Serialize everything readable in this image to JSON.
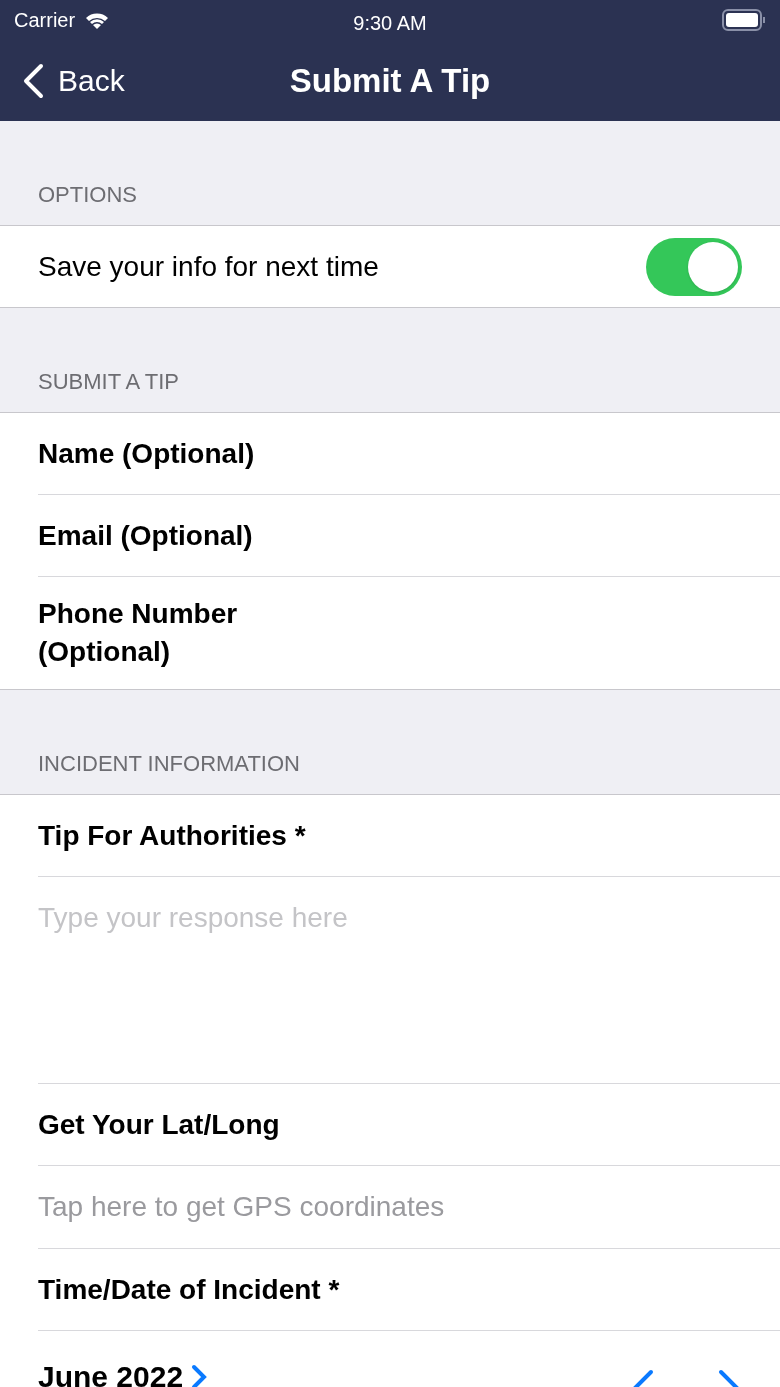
{
  "status_bar": {
    "carrier": "Carrier",
    "time": "9:30 AM"
  },
  "nav": {
    "back": "Back",
    "title": "Submit A Tip"
  },
  "sections": [
    {
      "header": "OPTIONS",
      "rows": [
        {
          "kind": "toggle",
          "label": "Save your info for next time",
          "on": true
        }
      ]
    },
    {
      "header": "SUBMIT A TIP",
      "rows": [
        {
          "kind": "field",
          "label": "Name (Optional)"
        },
        {
          "kind": "field",
          "label": "Email (Optional)"
        },
        {
          "kind": "field",
          "label": "Phone Number (Optional)"
        }
      ]
    },
    {
      "header": "INCIDENT INFORMATION",
      "rows": [
        {
          "kind": "field",
          "label": "Tip For Authorities *"
        },
        {
          "kind": "textarea",
          "placeholder": "Type your response here"
        },
        {
          "kind": "field",
          "label": "Get Your Lat/Long"
        },
        {
          "kind": "action",
          "label": "Tap here to get GPS coordinates"
        },
        {
          "kind": "field",
          "label": "Time/Date of Incident *"
        },
        {
          "kind": "calendar",
          "month": "June 2022"
        }
      ]
    }
  ]
}
